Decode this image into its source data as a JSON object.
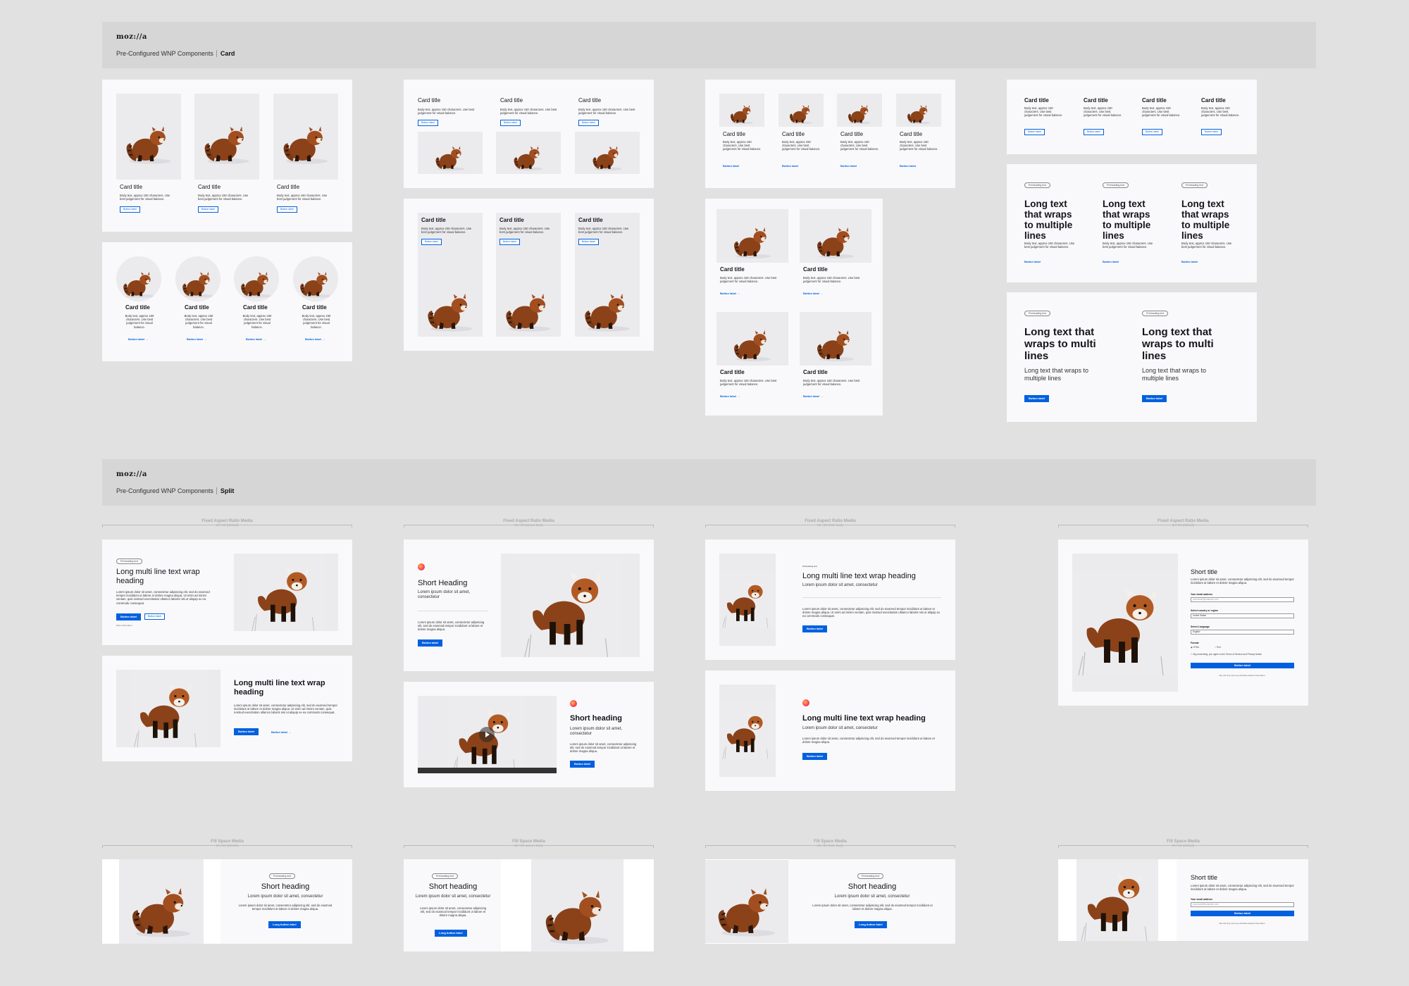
{
  "brand": {
    "logo": "moz://a",
    "accent": "#0060df"
  },
  "card_section": {
    "breadcrumb": "Pre-Configured WNP Components",
    "current": "Card"
  },
  "split_section": {
    "breadcrumb": "Pre-Configured WNP Components",
    "current": "Split"
  },
  "card": {
    "title": "Card title",
    "body": "Body text, approx 150 characters. Use best judgement for visual balance.",
    "button": "Button label",
    "link_arrow": "→",
    "pre": "Preheading text",
    "long_title": "Long text that wraps to multiple lines",
    "long_title2": "Long text that wraps to multi lines",
    "long_body": "Long text that wraps to multiple lines"
  },
  "split": {
    "labels": {
      "fixed": "Fixed Aspect Ratio Media",
      "fill": "Fill Space Media",
      "ratio_5050": "50 / 50 (default)",
      "ratio_3366": "33 / 66 Narrow Body",
      "ratio_6633": "66 / 33 Wide Body"
    },
    "pre": "Preheading text",
    "h_long": "Long multi line text wrap heading",
    "h_short": "Short Heading",
    "h_short2": "Short heading",
    "h_shortlc": "Short heading",
    "h_title": "Short title",
    "lorem_short": "Lorem ipsum dolor sit amet, consectetur",
    "lorem_long": "Lorem ipsum dolor sit amet, consectetur adipiscing elit, sed do eiusmod tempor incididunt ut labore et dolore magna aliqua. Ut enim ad minim veniam, quis nostrud exercitation ullamco laboris nisi ut aliquip ex ea commodo consequat.",
    "lorem_mid": "Lorem ipsum dolor sit amet, consectetur adipiscing elit, sed do eiusmod tempor incididunt ut labore et dolore magna aliqua.",
    "button": "Button label",
    "button_long": "Long button label",
    "more": "More information",
    "form": {
      "email_label": "Your email address",
      "email_ph": "yourname@example.com",
      "country_label": "Select country or region",
      "country": "United States",
      "lang_label": "Select Language",
      "lang": "English",
      "format_label": "Format",
      "html": "HTML",
      "text": "Text",
      "consent": "By proceeding, you agree to the Terms of Service and Privacy Notice",
      "footnote": "We will only send you Mozilla-related information.",
      "submit": "Button label"
    }
  }
}
